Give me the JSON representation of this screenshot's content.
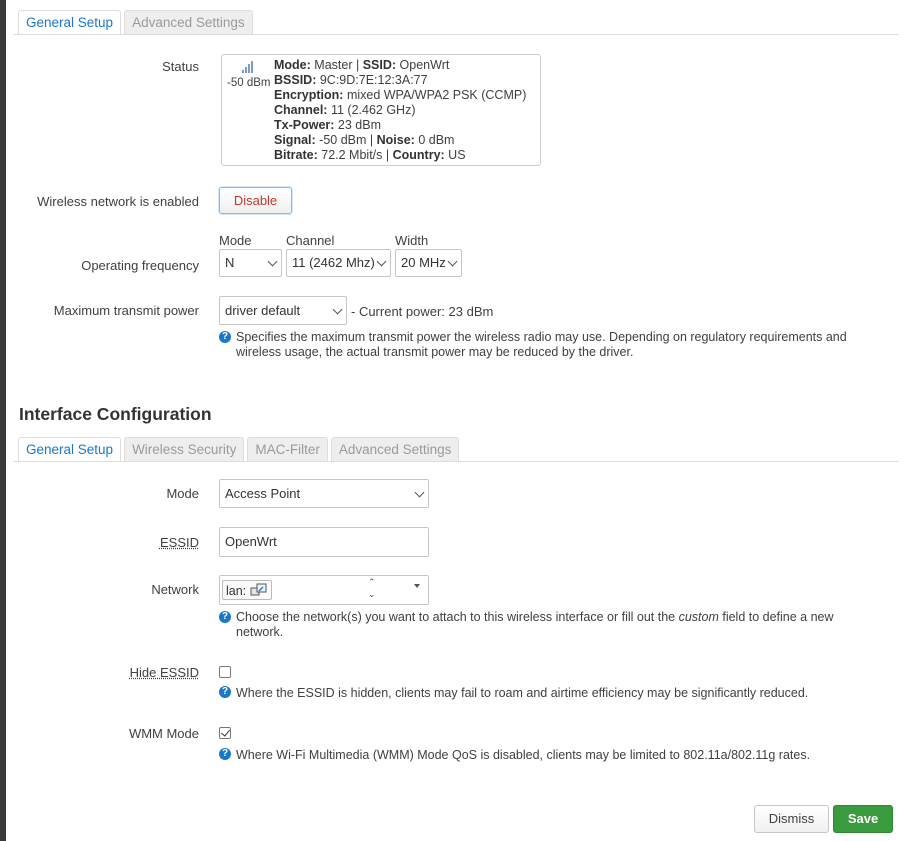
{
  "device_tabs": [
    "General Setup",
    "Advanced Settings"
  ],
  "status": {
    "label": "Status",
    "signal_icon": "signal-bars-icon",
    "signal_dbm": "-50 dBm",
    "line1_k1": "Mode:",
    "line1_v1": "Master",
    "line1_sep": "|",
    "line1_k2": "SSID:",
    "line1_v2": "OpenWrt",
    "line2_k": "BSSID:",
    "line2_v": "9C:9D:7E:12:3A:77",
    "line3_k": "Encryption:",
    "line3_v": "mixed WPA/WPA2 PSK (CCMP)",
    "line4_k": "Channel:",
    "line4_v": "11 (2.462 GHz)",
    "line5_k": "Tx-Power:",
    "line5_v": "23 dBm",
    "line6_k1": "Signal:",
    "line6_v1": "-50 dBm",
    "line6_sep": "|",
    "line6_k2": "Noise:",
    "line6_v2": "0 dBm",
    "line7_k1": "Bitrate:",
    "line7_v1": "72.2 Mbit/s",
    "line7_sep": "|",
    "line7_k2": "Country:",
    "line7_v2": "US"
  },
  "wireless_enabled": {
    "label": "Wireless network is enabled",
    "button": "Disable"
  },
  "operating_frequency": {
    "label": "Operating frequency",
    "mode_label": "Mode",
    "mode_value": "N",
    "channel_label": "Channel",
    "channel_value": "11 (2462 Mhz)",
    "width_label": "Width",
    "width_value": "20 MHz"
  },
  "tx_power": {
    "label": "Maximum transmit power",
    "value": "driver default",
    "current": "- Current power: 23 dBm",
    "help": "Specifies the maximum transmit power the wireless radio may use. Depending on regulatory requirements and wireless usage, the actual transmit power may be reduced by the driver."
  },
  "interface_config": {
    "heading": "Interface Configuration",
    "tabs": [
      "General Setup",
      "Wireless Security",
      "MAC-Filter",
      "Advanced Settings"
    ],
    "mode": {
      "label": "Mode",
      "value": "Access Point"
    },
    "essid": {
      "label": "ESSID",
      "value": "OpenWrt"
    },
    "network": {
      "label": "Network",
      "chip": "lan:",
      "chip_icon": "network-interfaces-icon",
      "help_before": "Choose the network(s) you want to attach to this wireless interface or fill out the ",
      "help_em": "custom",
      "help_after": " field to define a new network."
    },
    "hide_essid": {
      "label": "Hide ESSID",
      "checked": false,
      "help": "Where the ESSID is hidden, clients may fail to roam and airtime efficiency may be significantly reduced."
    },
    "wmm_mode": {
      "label": "WMM Mode",
      "checked": true,
      "help": "Where Wi-Fi Multimedia (WMM) Mode QoS is disabled, clients may be limited to 802.11a/802.11g rates."
    }
  },
  "footer": {
    "dismiss": "Dismiss",
    "save": "Save"
  },
  "colors": {
    "accent": "#1a77c9",
    "save": "#3a9a3e",
    "danger": "#c0392b"
  }
}
